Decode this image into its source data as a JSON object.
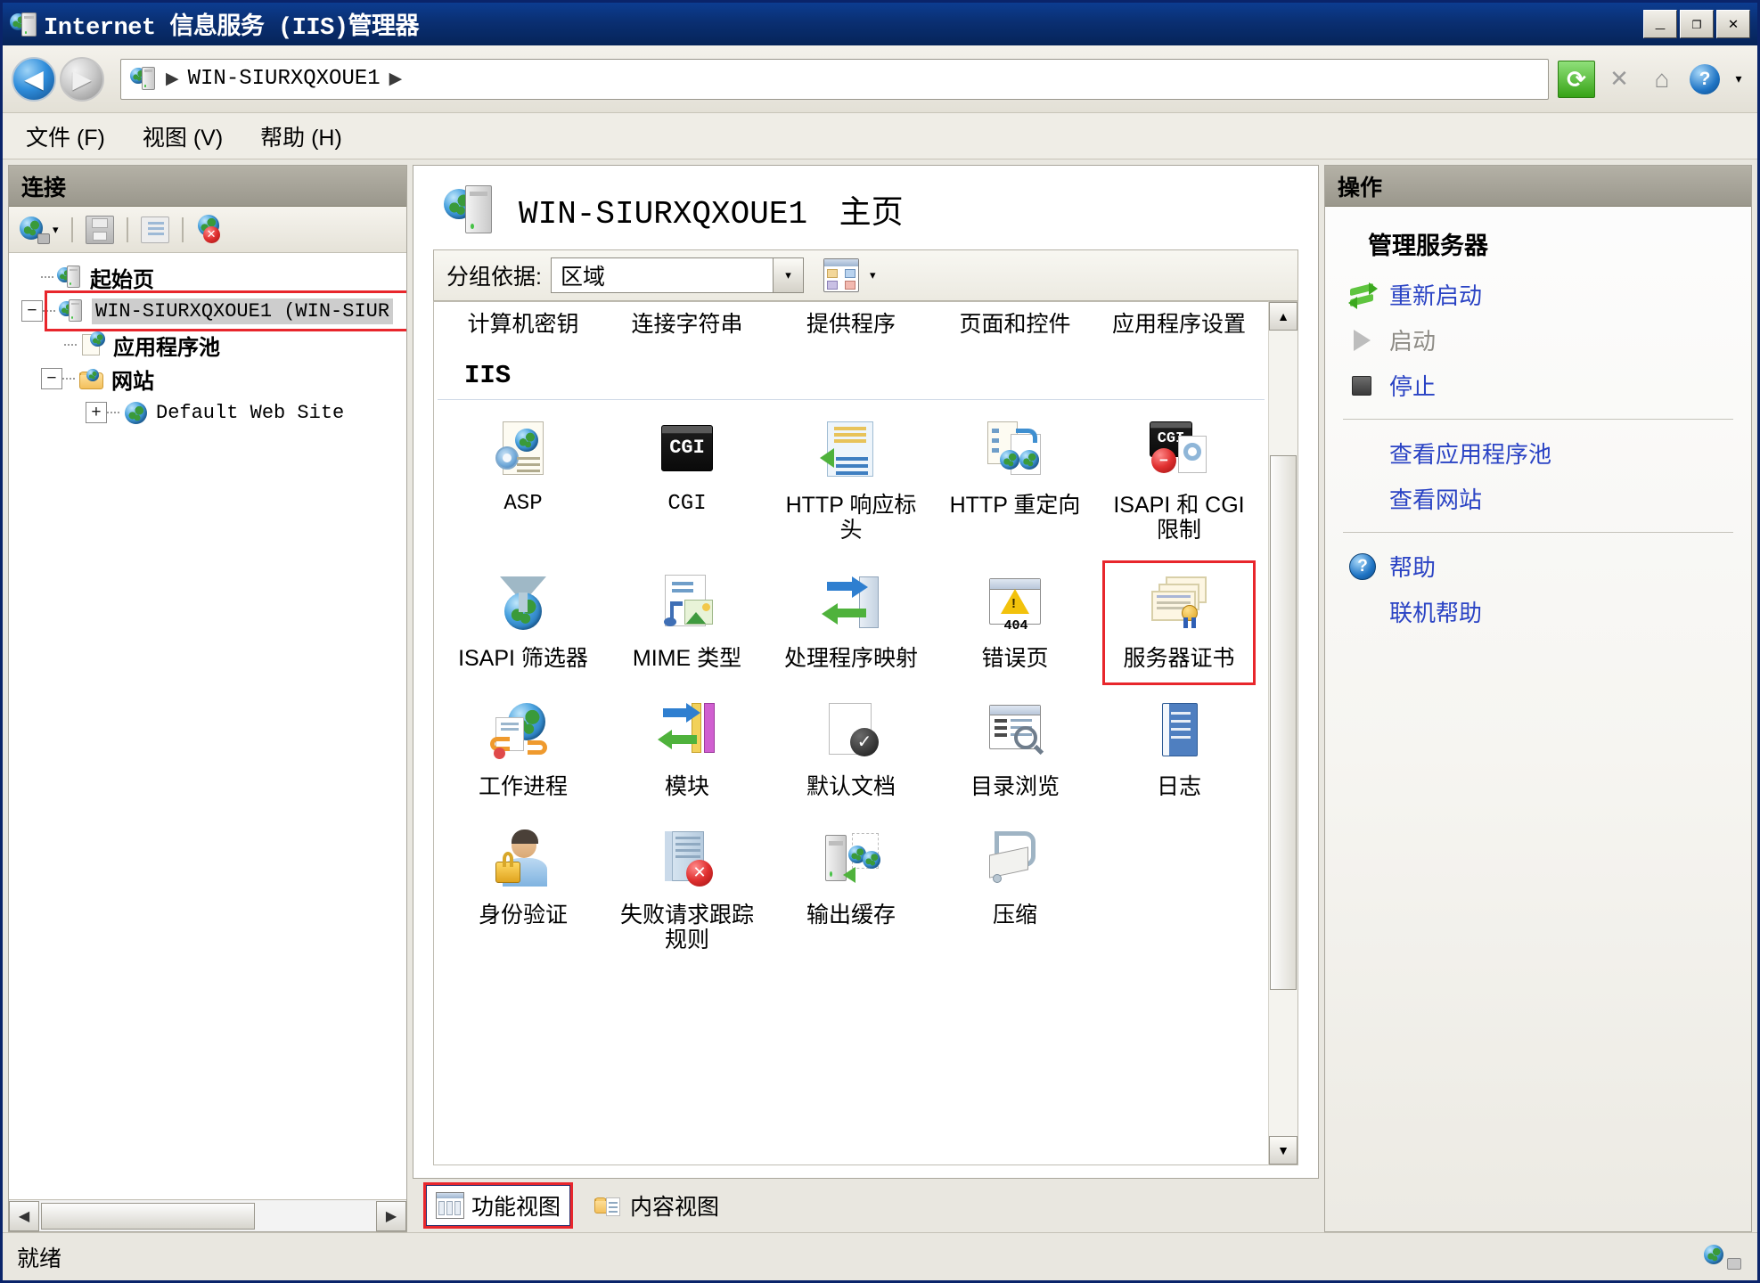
{
  "window": {
    "title": "Internet 信息服务 (IIS)管理器",
    "title_icon": "iis-server-icon",
    "minimize_label": "_",
    "maximize_label": "❐",
    "close_label": "✕"
  },
  "nav": {
    "back_icon": "back-arrow-icon",
    "forward_icon": "forward-arrow-icon",
    "address_icon": "server-globe-icon",
    "breadcrumb_sep": "▶",
    "breadcrumb": "WIN-SIURXQXOUE1",
    "breadcrumb_sep2": "▶",
    "tools": [
      {
        "name": "refresh-icon",
        "glyph": "⟳"
      },
      {
        "name": "stop-icon",
        "glyph": "✕"
      },
      {
        "name": "home-icon",
        "glyph": "⌂"
      },
      {
        "name": "help-icon",
        "glyph": "?"
      },
      {
        "name": "dropdown-caret-icon",
        "glyph": "▾"
      }
    ]
  },
  "menubar": {
    "items": [
      {
        "label": "文件 (F)",
        "name": "menu-file"
      },
      {
        "label": "视图 (V)",
        "name": "menu-view"
      },
      {
        "label": "帮助 (H)",
        "name": "menu-help"
      }
    ]
  },
  "connections": {
    "header": "连接",
    "toolbar": [
      {
        "name": "connect-icon",
        "glyph": "globe"
      },
      {
        "name": "connect-dropdown-caret",
        "glyph": "▾"
      },
      {
        "name": "save-connection-icon",
        "glyph": "save"
      },
      {
        "name": "export-connection-icon",
        "glyph": "export"
      },
      {
        "name": "delete-connection-icon",
        "glyph": "globe-x"
      }
    ],
    "tree": [
      {
        "label": "起始页",
        "icon": "start-page-icon",
        "expander": "",
        "indent": 1,
        "cjk": true,
        "selected": false
      },
      {
        "label": "WIN-SIURXQXOUE1 (WIN-SIUR",
        "icon": "server-icon",
        "expander": "−",
        "indent": 0,
        "cjk": false,
        "selected": true
      },
      {
        "label": "应用程序池",
        "icon": "app-pools-icon",
        "expander": "",
        "indent": 2,
        "cjk": true,
        "selected": false
      },
      {
        "label": "网站",
        "icon": "sites-folder-icon",
        "expander": "−",
        "indent": 1,
        "cjk": true,
        "selected": false
      },
      {
        "label": "Default Web Site",
        "icon": "website-icon",
        "expander": "+",
        "indent": 2,
        "cjk": false,
        "selected": false
      }
    ],
    "hscroll_left": "◀",
    "hscroll_right": "▶"
  },
  "main": {
    "page_icon": "server-home-icon",
    "page_title_id": "WIN-SIURXQXOUE1",
    "page_title_suffix": "主页",
    "filter": {
      "group_by_label": "分组依据:",
      "group_by_value": "区域",
      "dropdown_caret": "▾",
      "view_icon": "view-mode-icon",
      "view_caret": "▾"
    },
    "aspnet_row_cut": [
      {
        "label": "计算机密钥",
        "name": "feature-machine-key"
      },
      {
        "label": "连接字符串",
        "name": "feature-connection-strings"
      },
      {
        "label": "提供程序",
        "name": "feature-providers"
      },
      {
        "label": "页面和控件",
        "name": "feature-pages-and-controls"
      },
      {
        "label": "应用程序设置",
        "name": "feature-application-settings"
      }
    ],
    "section_title": "IIS",
    "features": [
      {
        "label": "ASP",
        "icon": "asp-icon",
        "mono": true,
        "highlight": false
      },
      {
        "label": "CGI",
        "icon": "cgi-icon",
        "mono": true,
        "highlight": false
      },
      {
        "label": "HTTP 响应标头",
        "icon": "http-response-headers-icon",
        "mono": false,
        "highlight": false
      },
      {
        "label": "HTTP 重定向",
        "icon": "http-redirect-icon",
        "mono": false,
        "highlight": false
      },
      {
        "label": "ISAPI 和 CGI 限制",
        "icon": "isapi-cgi-restrictions-icon",
        "mono": false,
        "highlight": false
      },
      {
        "label": "ISAPI 筛选器",
        "icon": "isapi-filters-icon",
        "mono": false,
        "highlight": false
      },
      {
        "label": "MIME 类型",
        "icon": "mime-types-icon",
        "mono": false,
        "highlight": false
      },
      {
        "label": "处理程序映射",
        "icon": "handler-mappings-icon",
        "mono": false,
        "highlight": false
      },
      {
        "label": "错误页",
        "icon": "error-pages-icon",
        "mono": false,
        "highlight": false
      },
      {
        "label": "服务器证书",
        "icon": "server-certificates-icon",
        "mono": false,
        "highlight": true
      },
      {
        "label": "工作进程",
        "icon": "worker-processes-icon",
        "mono": false,
        "highlight": false
      },
      {
        "label": "模块",
        "icon": "modules-icon",
        "mono": false,
        "highlight": false
      },
      {
        "label": "默认文档",
        "icon": "default-document-icon",
        "mono": false,
        "highlight": false
      },
      {
        "label": "目录浏览",
        "icon": "directory-browsing-icon",
        "mono": false,
        "highlight": false
      },
      {
        "label": "日志",
        "icon": "logging-icon",
        "mono": false,
        "highlight": false
      },
      {
        "label": "身份验证",
        "icon": "authentication-icon",
        "mono": false,
        "highlight": false
      },
      {
        "label": "失败请求跟踪规则",
        "icon": "failed-request-tracing-icon",
        "mono": false,
        "highlight": false
      },
      {
        "label": "输出缓存",
        "icon": "output-caching-icon",
        "mono": false,
        "highlight": false
      },
      {
        "label": "压缩",
        "icon": "compression-icon",
        "mono": false,
        "highlight": false
      }
    ],
    "scroll_up": "▲",
    "scroll_down": "▼",
    "tabs": [
      {
        "label": "功能视图",
        "icon": "features-view-icon",
        "active": true
      },
      {
        "label": "内容视图",
        "icon": "content-view-icon",
        "active": false
      }
    ]
  },
  "actions": {
    "header": "操作",
    "group_title": "管理服务器",
    "items": [
      {
        "label": "重新启动",
        "icon": "restart-icon",
        "disabled": false,
        "has_icon": true
      },
      {
        "label": "启动",
        "icon": "start-icon",
        "disabled": true,
        "has_icon": true
      },
      {
        "label": "停止",
        "icon": "stop-square-icon",
        "disabled": false,
        "has_icon": true
      }
    ],
    "links": [
      {
        "label": "查看应用程序池",
        "name": "view-application-pools-link"
      },
      {
        "label": "查看网站",
        "name": "view-sites-link"
      }
    ],
    "help": [
      {
        "label": "帮助",
        "icon": "help-circle-icon",
        "has_icon": true
      },
      {
        "label": "联机帮助",
        "icon": "",
        "has_icon": false
      }
    ]
  },
  "statusbar": {
    "text": "就绪",
    "right_icon": "connection-status-icon"
  },
  "colors": {
    "title_bar": "#0a2f72",
    "accent_link": "#2a43c4",
    "highlight_box": "#e8262c",
    "panel_header": "#9a978c"
  }
}
